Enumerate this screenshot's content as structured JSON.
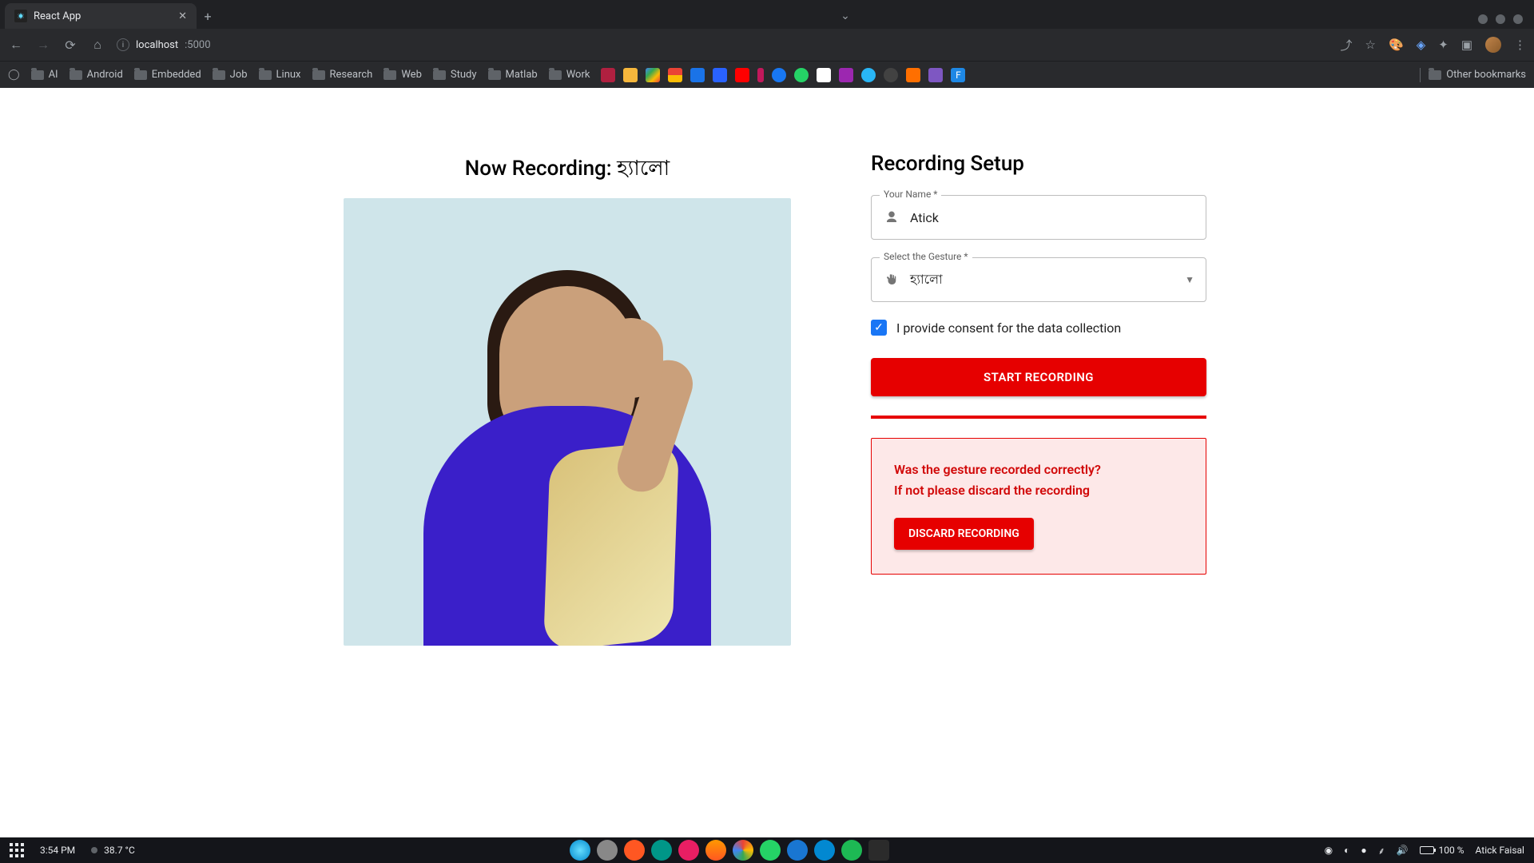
{
  "browser": {
    "tab_title": "React App",
    "url_host": "localhost",
    "url_port": ":5000"
  },
  "bookmarks": {
    "folders": [
      "AI",
      "Android",
      "Embedded",
      "Job",
      "Linux",
      "Research",
      "Web",
      "Study",
      "Matlab",
      "Work"
    ],
    "other": "Other bookmarks"
  },
  "left_panel": {
    "heading_prefix": "Now Recording: ",
    "heading_word": "হ্যালো"
  },
  "form": {
    "title": "Recording Setup",
    "name_label": "Your Name *",
    "name_value": "Atick",
    "gesture_label": "Select the Gesture *",
    "gesture_value": "হ্যালো",
    "consent_label": "I provide consent for the data collection",
    "consent_checked": true,
    "start_button": "START RECORDING",
    "alert_line1": "Was the gesture recorded correctly?",
    "alert_line2": "If not please discard the recording",
    "discard_button": "DISCARD RECORDING"
  },
  "taskbar": {
    "time": "3:54 PM",
    "temp": "38.7 °C",
    "battery": "100 %",
    "user": "Atick Faisal"
  }
}
